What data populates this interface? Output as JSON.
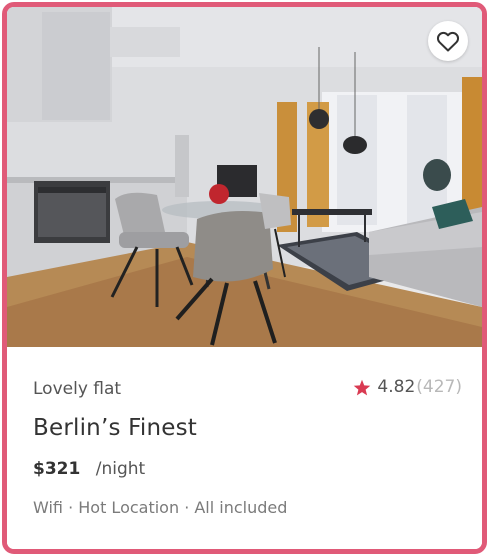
{
  "listing": {
    "category": "Lovely flat",
    "title": "Berlin’s Finest",
    "price": "$321",
    "price_unit": "/night",
    "amenities": "Wifi · Hot Location · All included",
    "rating": {
      "score": "4.82",
      "count": "(427)"
    }
  },
  "icons": {
    "favorite": "heart-outline-icon",
    "rating": "star-icon"
  },
  "colors": {
    "card_border": "#e05a78",
    "star": "#d93a52"
  }
}
